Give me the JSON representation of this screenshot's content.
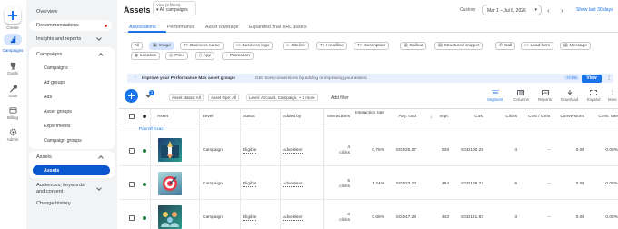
{
  "rail": {
    "create": "Create",
    "campaigns": "Campaigns",
    "goals": "Goals",
    "tools": "Tools",
    "billing": "Billing",
    "admin": "Admin"
  },
  "nav": {
    "overview": "Overview",
    "recommendations": "Recommendations",
    "insights": "Insights and reports",
    "campaigns_group": "Campaigns",
    "campaigns_items": [
      "Campaigns",
      "Ad groups",
      "Ads",
      "Asset groups",
      "Experiments",
      "Campaign groups"
    ],
    "assets_group": "Assets",
    "assets_item": "Assets",
    "audiences": "Audiences, keywords, and content",
    "change_history": "Change history"
  },
  "header": {
    "title": "Assets",
    "view_label": "View (2 filters)",
    "view_value": "All campaigns",
    "custom": "Custom",
    "date_range": "Mar 1 – Jul 8, 2026",
    "show_last": "Show last 30 days"
  },
  "tabs": [
    "Associations",
    "Performance",
    "Asset coverage",
    "Expanded final URL assets"
  ],
  "chips_row1": [
    "All",
    "Image",
    "Business name",
    "Business logo",
    "Sitelink",
    "Headline",
    "Description",
    "Callout",
    "Structured snippet",
    "Call",
    "Lead form",
    "Message"
  ],
  "chips_row2": [
    "Location",
    "Price",
    "App",
    "Promotion"
  ],
  "banner": {
    "title": "Improve your Performance Max asset groups",
    "text": "Get more conversions by adding or improving your assets",
    "score": "+7.5%",
    "view": "View"
  },
  "toolbar": {
    "filter_count": "3",
    "filters": [
      "Asset status: All",
      "Asset type: All",
      "Level: Account, Campaign, + 1 more"
    ],
    "add_filter": "Add filter",
    "tools": [
      "Segment",
      "Columns",
      "Reports",
      "Download",
      "Expand",
      "More"
    ]
  },
  "columns": [
    "Asset",
    "Level",
    "Status",
    "Added by",
    "Interactions",
    "Interaction rate",
    "Avg. cost",
    "Impr.",
    "Cost",
    "Clicks",
    "Cost / conv.",
    "Conversions",
    "Conv. rate"
  ],
  "group_label": "Payroll Exact",
  "rows": [
    {
      "level": "Campaign",
      "status": "Eligible",
      "added_by": "Advertiser",
      "interactions": "4",
      "interactions_unit": "clicks",
      "interaction_rate": "0.76%",
      "avg_cost": "SGD25.07",
      "impr": "528",
      "cost": "SGD100.29",
      "clicks": "4",
      "cost_conv": "--",
      "conversions": "0.00",
      "conv_rate": "0.00%"
    },
    {
      "level": "Campaign",
      "status": "Eligible",
      "added_by": "Advertiser",
      "interactions": "5",
      "interactions_unit": "clicks",
      "interaction_rate": "1.24%",
      "avg_cost": "SGD23.20",
      "impr": "484",
      "cost": "SGD139.22",
      "clicks": "6",
      "cost_conv": "--",
      "conversions": "0.00",
      "conv_rate": "0.00%"
    },
    {
      "level": "Campaign",
      "status": "Eligible",
      "added_by": "Advertiser",
      "interactions": "3",
      "interactions_unit": "clicks",
      "interaction_rate": "0.68%",
      "avg_cost": "SGD47.28",
      "impr": "443",
      "cost": "SGD141.83",
      "clicks": "3",
      "cost_conv": "--",
      "conversions": "0.00",
      "conv_rate": "0.00%"
    }
  ],
  "colors": {
    "accent": "#1a73e8",
    "green": "#188038",
    "nav_bg": "#f1f3f4",
    "selected": "#d3e3fd"
  }
}
